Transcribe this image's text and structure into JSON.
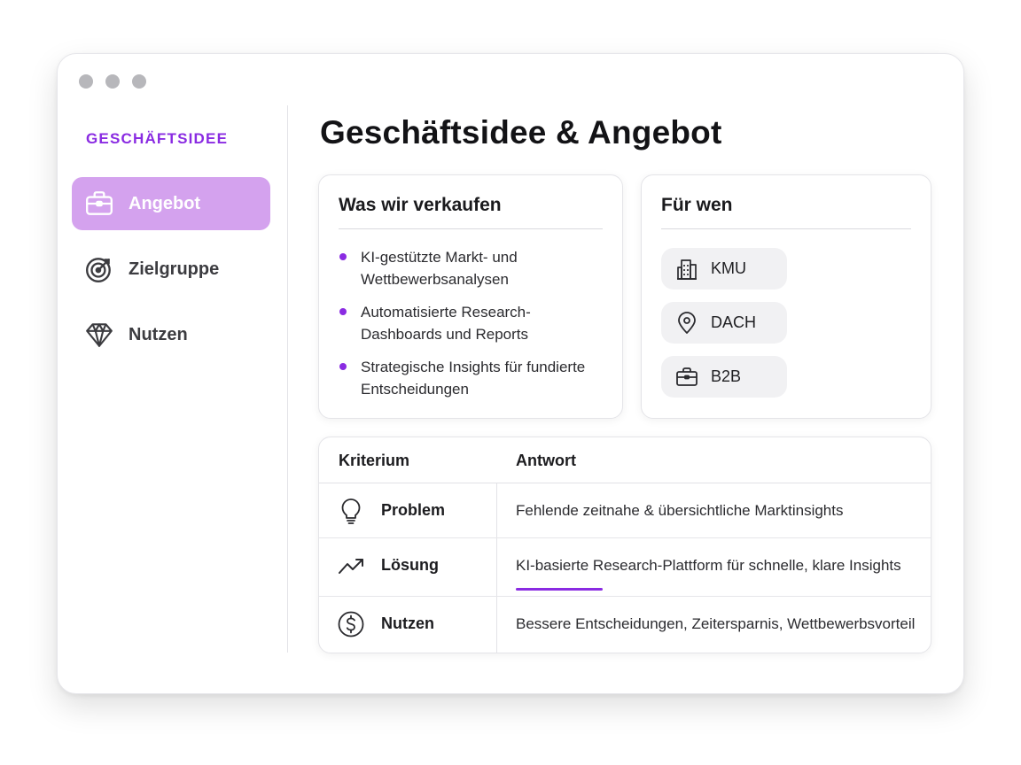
{
  "sidebar": {
    "brand": "GESCHÄFTSIDEE",
    "items": [
      {
        "label": "Angebot",
        "icon": "briefcase-icon",
        "active": true
      },
      {
        "label": "Zielgruppe",
        "icon": "target-icon",
        "active": false
      },
      {
        "label": "Nutzen",
        "icon": "diamond-icon",
        "active": false
      }
    ]
  },
  "main": {
    "title": "Geschäftsidee & Angebot",
    "offer_card": {
      "title": "Was wir verkaufen",
      "bullets": [
        "KI-gestützte Markt- und Wettbewerbsanalysen",
        "Automatisierte Research-Dashboards und Reports",
        "Strategische Insights für fundierte Entscheidungen"
      ]
    },
    "audience_card": {
      "title": "Für wen",
      "chips": [
        {
          "label": "KMU",
          "icon": "building-icon"
        },
        {
          "label": "DACH",
          "icon": "location-pin-icon"
        },
        {
          "label": "B2B",
          "icon": "briefcase-icon"
        }
      ]
    },
    "table": {
      "headers": [
        "Kriterium",
        "Antwort"
      ],
      "rows": [
        {
          "icon": "lightbulb-icon",
          "label": "Problem",
          "value": "Fehlende zeitnahe & übersichtliche Marktinsights"
        },
        {
          "icon": "trend-up-icon",
          "label": "Lösung",
          "value": "KI-basierte Research-Plattform für schnelle, klare Insights"
        },
        {
          "icon": "dollar-icon",
          "label": "Nutzen",
          "value": "Bessere Entscheidungen, Zeitersparnis, Wettbewerbsvorteil"
        }
      ]
    }
  },
  "colors": {
    "accent": "#8a2be2",
    "active_item_bg": "#d4a2ee",
    "chip_bg": "#f1f1f3"
  }
}
